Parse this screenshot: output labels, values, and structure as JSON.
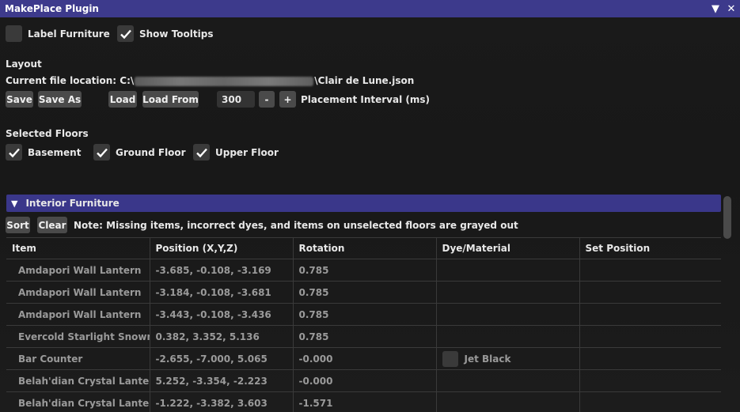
{
  "window": {
    "title": "MakePlace Plugin"
  },
  "options": {
    "label_furniture": "Label Furniture",
    "label_furniture_checked": false,
    "show_tooltips": "Show Tooltips",
    "show_tooltips_checked": true
  },
  "layout": {
    "heading": "Layout",
    "file_prefix": "Current file location: C:\\",
    "file_suffix": "\\Clair de Lune.json",
    "save": "Save",
    "save_as": "Save As",
    "load": "Load",
    "load_from": "Load From",
    "interval_value": "300",
    "minus": "-",
    "plus": "+",
    "interval_label": "Placement Interval (ms)"
  },
  "floors": {
    "heading": "Selected Floors",
    "basement": "Basement",
    "ground": "Ground Floor",
    "upper": "Upper Floor"
  },
  "interior": {
    "header": "Interior Furniture",
    "sort": "Sort",
    "clear": "Clear",
    "note": "Note: Missing items, incorrect dyes, and items on unselected floors are grayed out",
    "columns": [
      "Item",
      "Position (X,Y,Z)",
      "Rotation",
      "Dye/Material",
      "Set Position"
    ],
    "rows": [
      {
        "item": "Amdapori Wall Lantern",
        "position": "-3.685, -0.108, -3.169",
        "rotation": "0.785",
        "dye": "",
        "icon": "lantern-icon"
      },
      {
        "item": "Amdapori Wall Lantern",
        "position": "-3.184, -0.108, -3.681",
        "rotation": "0.785",
        "dye": "",
        "icon": "lantern-icon"
      },
      {
        "item": "Amdapori Wall Lantern",
        "position": "-3.443, -0.108, -3.436",
        "rotation": "0.785",
        "dye": "",
        "icon": "lantern-icon"
      },
      {
        "item": "Evercold Starlight Snowm",
        "position": "0.382, 3.352, 5.136",
        "rotation": "0.785",
        "dye": "",
        "icon": "snowman-icon"
      },
      {
        "item": "Bar Counter",
        "position": "-2.655, -7.000, 5.065",
        "rotation": "-0.000",
        "dye": "Jet Black",
        "icon": "counter-icon"
      },
      {
        "item": "Belah'dian Crystal Lanter",
        "position": "5.252, -3.354, -2.223",
        "rotation": "-0.000",
        "dye": "",
        "icon": "crystal-lantern-icon"
      },
      {
        "item": "Belah'dian Crystal Lanter",
        "position": "-1.222, -3.382, 3.603",
        "rotation": "-1.571",
        "dye": "",
        "icon": "crystal-lantern-icon"
      }
    ]
  }
}
